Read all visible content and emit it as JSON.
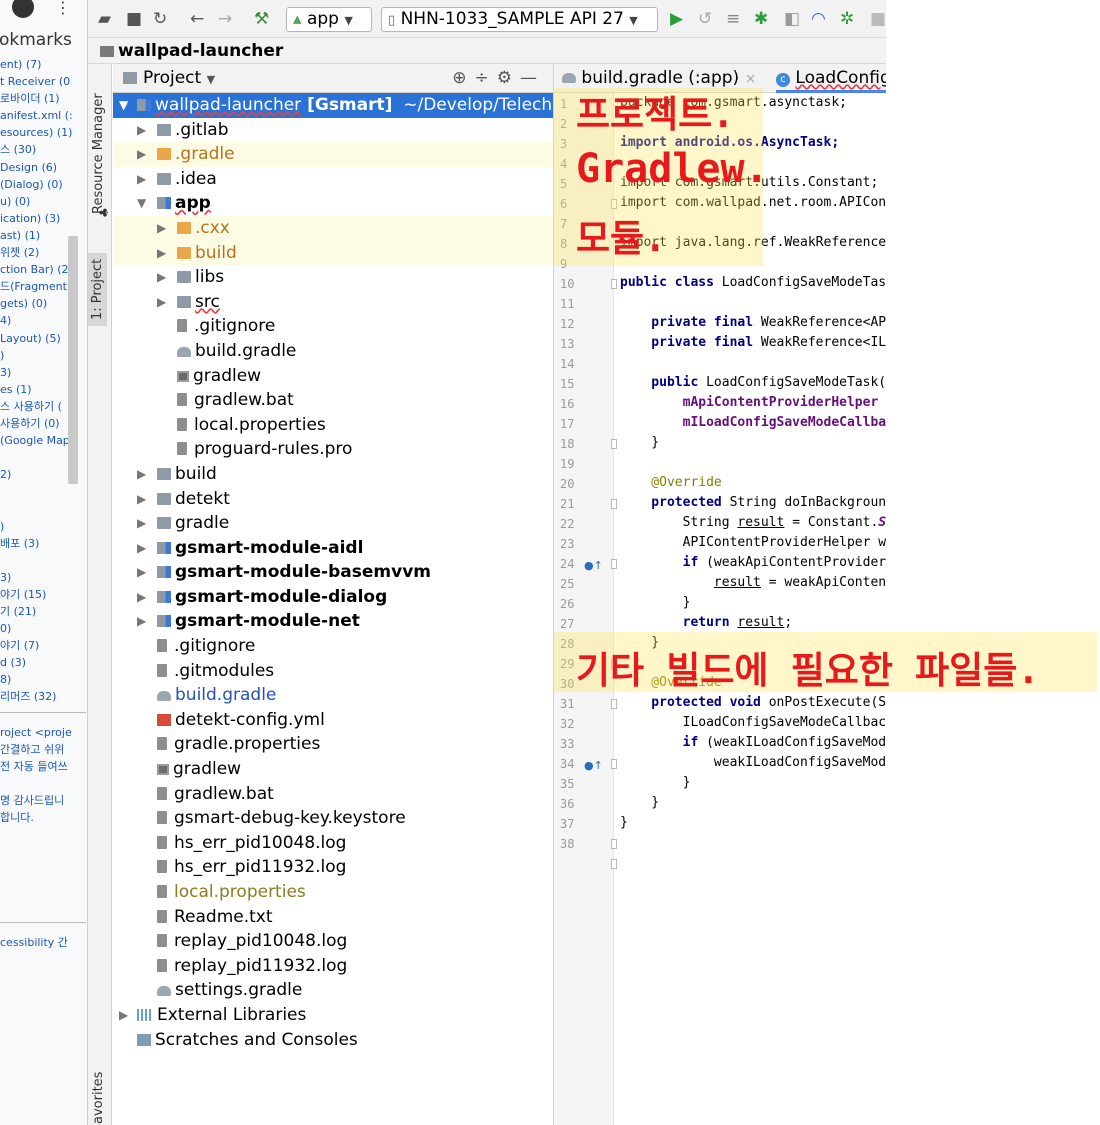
{
  "browser_sidebar": {
    "title": "okmarks",
    "items": [
      "ent) (7)",
      "t Receiver (0",
      "로바이더 (1)",
      "anifest.xml (:",
      "esources) (1)",
      "스 (30)",
      "Design (6)",
      "(Dialog) (0)",
      "u) (0)",
      "ication) (3)",
      "ast) (1)",
      "위젯 (2)",
      "ction Bar) (2)",
      "드(Fragment)",
      "gets) (0)",
      "4)",
      "Layout) (5)",
      ")",
      "3)",
      "es (1)",
      "스 사용하기 (",
      "사용하기 (0)",
      "(Google Map",
      "",
      "2)",
      "",
      "",
      ")",
      "배포 (3)",
      "",
      "3)",
      "야기 (15)",
      "기 (21)",
      "0)",
      "야기 (7)",
      "d (3)",
      "8)",
      "리머즈 (32)"
    ],
    "items2": [
      "roject <proje",
      "간결하고 쉬위",
      "전 자동 들여쓰",
      "",
      "명 감사드립니",
      "합니다."
    ],
    "items3": [
      "cessibility 간"
    ]
  },
  "toolbar": {
    "run_config": "app",
    "device": "NHN-1033_SAMPLE API 27"
  },
  "navbar": {
    "breadcrumb": "wallpad-launcher"
  },
  "side_tabs": {
    "resource_manager": "Resource Manager",
    "project": "1: Project",
    "favorites": "avorites"
  },
  "project_panel": {
    "title": "Project",
    "tree": [
      {
        "label": "wallpad-launcher",
        "suffix": " [Gsmart]",
        "path": "~/Develop/Telechi"
      },
      {
        "label": ".gitlab"
      },
      {
        "label": ".gradle"
      },
      {
        "label": ".idea"
      },
      {
        "label": "app"
      },
      {
        "label": ".cxx"
      },
      {
        "label": "build"
      },
      {
        "label": "libs"
      },
      {
        "label": "src"
      },
      {
        "label": ".gitignore"
      },
      {
        "label": "build.gradle"
      },
      {
        "label": "gradlew"
      },
      {
        "label": "gradlew.bat"
      },
      {
        "label": "local.properties"
      },
      {
        "label": "proguard-rules.pro"
      },
      {
        "label": "build"
      },
      {
        "label": "detekt"
      },
      {
        "label": "gradle"
      },
      {
        "label": "gsmart-module-aidl"
      },
      {
        "label": "gsmart-module-basemvvm"
      },
      {
        "label": "gsmart-module-dialog"
      },
      {
        "label": "gsmart-module-net"
      },
      {
        "label": ".gitignore"
      },
      {
        "label": ".gitmodules"
      },
      {
        "label": "build.gradle"
      },
      {
        "label": "detekt-config.yml"
      },
      {
        "label": "gradle.properties"
      },
      {
        "label": "gradlew"
      },
      {
        "label": "gradlew.bat"
      },
      {
        "label": "gsmart-debug-key.keystore"
      },
      {
        "label": "hs_err_pid10048.log"
      },
      {
        "label": "hs_err_pid11932.log"
      },
      {
        "label": "local.properties"
      },
      {
        "label": "Readme.txt"
      },
      {
        "label": "replay_pid10048.log"
      },
      {
        "label": "replay_pid11932.log"
      },
      {
        "label": "settings.gradle"
      },
      {
        "label": "External Libraries"
      },
      {
        "label": "Scratches and Consoles"
      }
    ]
  },
  "editor": {
    "tabs": [
      {
        "label": "build.gradle (:app)"
      },
      {
        "label": "LoadConfig"
      }
    ],
    "line_numbers": [
      "1",
      "2",
      "3",
      "4",
      "5",
      "6",
      "7",
      "8",
      "9",
      "10",
      "11",
      "12",
      "13",
      "14",
      "15",
      "16",
      "17",
      "18",
      "19",
      "20",
      "21",
      "22",
      "23",
      "24",
      "25",
      "26",
      "27",
      "28",
      "29",
      "30",
      "31",
      "32",
      "33",
      "34",
      "35",
      "36",
      "37",
      "38"
    ],
    "lines": {
      "l1": "package com.gsmart.asynctask;",
      "l3": "import android.os.AsyncTask;",
      "l5": "import com.gsmart.utils.Constant;",
      "l6": "import com.wallpad.net.room.APICon",
      "l8": "import java.lang.ref.WeakReference",
      "l10a": "public class",
      "l10b": " LoadConfigSaveModeTas",
      "l12a": "    private final",
      "l12b": " WeakReference<AP",
      "l13a": "    private final",
      "l13b": " WeakReference<IL",
      "l15a": "    public",
      "l15b": " LoadConfigSaveModeTask(",
      "l16": "        mApiContentProviderHelper",
      "l17": "        mILoadConfigSaveModeCallba",
      "l18": "    }",
      "l20": "    @Override",
      "l21a": "    protected",
      "l21b": " String doInBackgroun",
      "l22a": "        String ",
      "l22b": "result",
      "l22c": " = Constant.",
      "l22d": "S",
      "l23": "        APIContentProviderHelper w",
      "l24a": "        if",
      "l24b": " (weakApiContentProvider",
      "l25a": "            ",
      "l25b": "result",
      "l25c": " = weakApiConten",
      "l26": "        }",
      "l27a": "        return",
      "l27b": "result",
      "l27c": ";",
      "l28": "    }",
      "l30": "    @Override",
      "l31a": "    protected void",
      "l31b": " onPostExecute(S",
      "l32": "        ILoadConfigSaveModeCallbac",
      "l33a": "        if",
      "l33b": " (weakILoadConfigSaveMod",
      "l34": "            weakILoadConfigSaveMod",
      "l35": "        }",
      "l36": "    }",
      "l37": "}"
    }
  },
  "annotations": {
    "project_line": "프로젝트.",
    "gradlew_line": "Gradlew.",
    "module_line": "모듈.",
    "other_line": "기타 빌드에 필요한 파일들."
  }
}
